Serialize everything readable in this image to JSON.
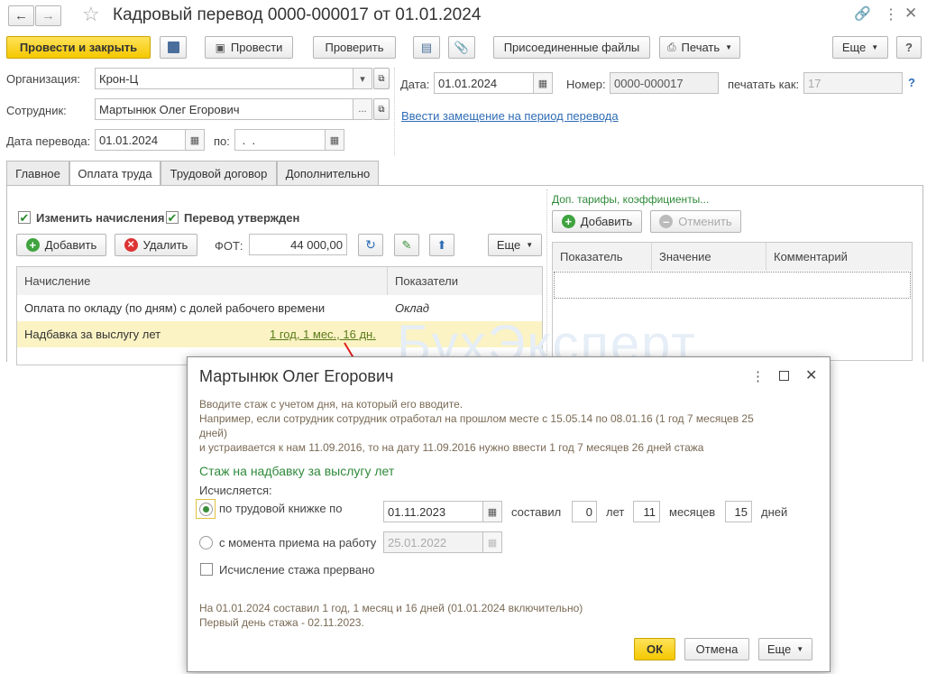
{
  "window": {
    "title": "Кадровый перевод 0000-000017 от 01.01.2024"
  },
  "toolbar": {
    "post_close": "Провести и закрыть",
    "post": "Провести",
    "check": "Проверить",
    "attached_files": "Присоединенные файлы",
    "print": "Печать",
    "more": "Еще"
  },
  "form": {
    "org_label": "Организация:",
    "org_value": "Крон-Ц",
    "employee_label": "Сотрудник:",
    "employee_value": "Мартынюк Олег Егорович",
    "date_transfer_label": "Дата перевода:",
    "date_transfer_value": "01.01.2024",
    "to_label": "по:",
    "to_value": " .  .",
    "date_label": "Дата:",
    "date_value": "01.01.2024",
    "number_label": "Номер:",
    "number_value": "0000-000017",
    "print_as_label": "печатать как:",
    "print_as_value": "17",
    "help": "?",
    "replacement_link": "Ввести замещение на период перевода"
  },
  "tabs": [
    "Главное",
    "Оплата труда",
    "Трудовой договор",
    "Дополнительно"
  ],
  "pay": {
    "change_accruals": "Изменить начисления",
    "transfer_approved": "Перевод утвержден",
    "add": "Добавить",
    "delete": "Удалить",
    "fot_label": "ФОТ:",
    "fot_value": "44 000,00",
    "more": "Еще",
    "columns": [
      "Начисление",
      "Показатели"
    ],
    "rows": [
      {
        "name": "Оплата по окладу (по дням) с долей рабочего времени",
        "value": "Оклад"
      },
      {
        "name": "Надбавка за выслугу лет",
        "value": "1 год, 1 мес., 16 дн."
      }
    ]
  },
  "extra": {
    "title": "Доп. тарифы, коэффициенты...",
    "add": "Добавить",
    "cancel": "Отменить",
    "columns": [
      "Показатель",
      "Значение",
      "Комментарий"
    ]
  },
  "watermark": "БухЭксперт",
  "dialog": {
    "title": "Мартынюк Олег Егорович",
    "hint1": "Вводите стаж с учетом дня, на который его вводите.",
    "hint2": "Например, если сотрудник сотрудник отработал на прошлом месте с 15.05.14 по 08.01.16 (1 год 7 месяцев 25",
    "hint3": "дней)",
    "hint4": "и устраивается к нам 11.09.2016, то на дату 11.09.2016 нужно ввести 1 год 7 месяцев 26 дней стажа",
    "section": "Стаж на надбавку за выслугу лет",
    "calc_label": "Исчисляется:",
    "opt1": "по трудовой книжке по",
    "opt1_date": "01.11.2023",
    "made": "составил",
    "years": "0",
    "years_lbl": "лет",
    "months": "11",
    "months_lbl": "месяцев",
    "days": "15",
    "days_lbl": "дней",
    "opt2": "с момента приема на работу",
    "opt2_date": "25.01.2022",
    "interrupted": "Исчисление стажа прервано",
    "summary1": "На 01.01.2024 составил 1 год, 1 месяц и 16 дней (01.01.2024 включительно)",
    "summary2": "Первый день стажа - 02.11.2023.",
    "ok": "ОК",
    "cancel": "Отмена",
    "more": "Еще"
  },
  "colors": {
    "accent_yellow": "#f5c800",
    "green": "#2f8a3a",
    "link": "#2f6db5",
    "hint": "#7a6a55",
    "row_highlight": "#fbf3c4"
  }
}
